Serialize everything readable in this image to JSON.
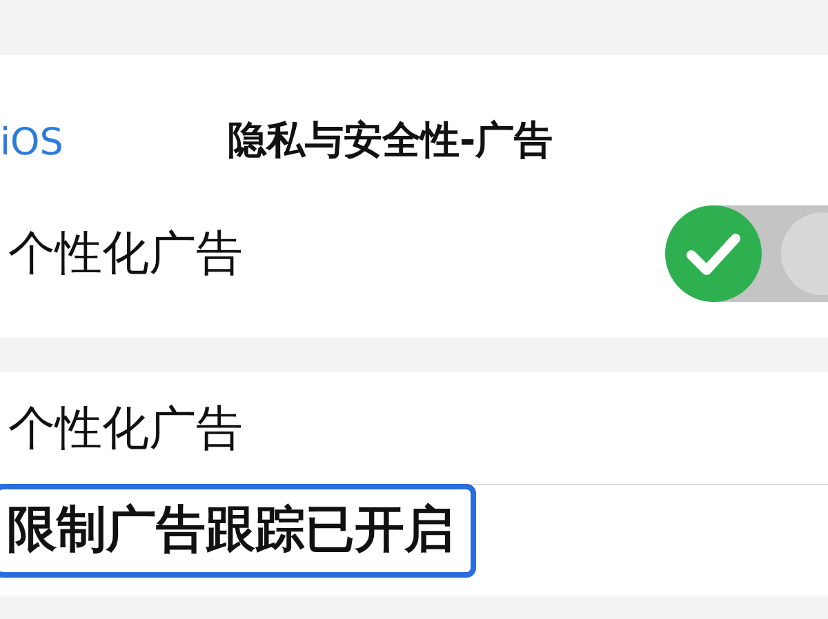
{
  "nav": {
    "back": "iOS",
    "title": "隐私与安全性-广告"
  },
  "toggle_row": {
    "label": "个性化广告",
    "on": true
  },
  "section": {
    "label": "个性化广告",
    "note": "限制广告跟踪已开启"
  }
}
